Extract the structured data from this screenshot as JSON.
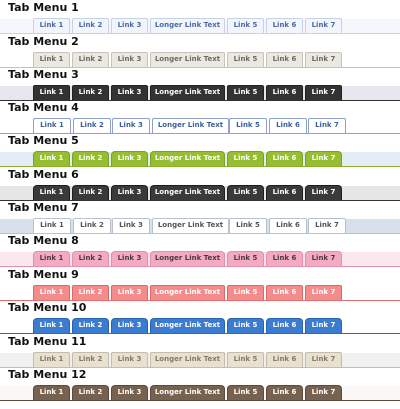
{
  "tabs": [
    "Link 1",
    "Link 2",
    "Link 3",
    "Longer Link Text",
    "Link 5",
    "Link 6",
    "Link 7"
  ],
  "menus": [
    {
      "title": "Tab Menu 1",
      "colors": {
        "bar": "#f4f7fc",
        "line": "#c6d3e6",
        "tab_bg": "#f2f5fb",
        "tab_fg": "#4a6aa6",
        "tab_border": "#c6d3e6"
      }
    },
    {
      "title": "Tab Menu 2",
      "colors": {
        "bar": "#ffffff",
        "line": "#c9c2b8",
        "tab_bg": "#ebe7e1",
        "tab_fg": "#6e6a64",
        "tab_border": "#c9c2b8"
      }
    },
    {
      "title": "Tab Menu 3",
      "colors": {
        "bar": "#e6e6ee",
        "line": "#333333",
        "tab_bg": "#333333",
        "tab_fg": "#ffffff",
        "tab_border": "#222222"
      }
    },
    {
      "title": "Tab Menu 4",
      "colors": {
        "bar": "#ffffff",
        "line": "#8aa2cc",
        "tab_bg": "#ffffff",
        "tab_fg": "#3e5f99",
        "tab_border": "#8aa2cc"
      }
    },
    {
      "title": "Tab Menu 5",
      "colors": {
        "bar": "#e4ecf6",
        "line": "#8dae2c",
        "tab_bg": "#96be32",
        "tab_fg": "#ffffff",
        "tab_border": "#7ea024"
      }
    },
    {
      "title": "Tab Menu 6",
      "colors": {
        "bar": "#e6e6e6",
        "line": "#333333",
        "tab_bg": "#3a3a3a",
        "tab_fg": "#ffffff",
        "tab_border": "#1e1e1e"
      }
    },
    {
      "title": "Tab Menu 7",
      "colors": {
        "bar": "#d8e0ea",
        "line": "#b8c2ce",
        "tab_bg": "#ffffff",
        "tab_fg": "#555555",
        "tab_border": "#b8c2ce"
      }
    },
    {
      "title": "Tab Menu 8",
      "colors": {
        "bar": "#fbe8ef",
        "line": "#e48fae",
        "tab_bg": "#f4a9c4",
        "tab_fg": "#4a3a40",
        "tab_border": "#e48fae"
      }
    },
    {
      "title": "Tab Menu 9",
      "colors": {
        "bar": "#ffffff",
        "line": "#e07070",
        "tab_bg": "#f48c8c",
        "tab_fg": "#ffffff",
        "tab_border": "#d86a6a"
      }
    },
    {
      "title": "Tab Menu 10",
      "colors": {
        "bar": "#ffffff",
        "line": "#2f69b8",
        "tab_bg": "#3b7cd0",
        "tab_fg": "#ffffff",
        "tab_border": "#2a62ae"
      }
    },
    {
      "title": "Tab Menu 11",
      "colors": {
        "bar": "#f1f1f1",
        "line": "#c8bda6",
        "tab_bg": "#e9e1d0",
        "tab_fg": "#857a66",
        "tab_border": "#c8bda6"
      }
    },
    {
      "title": "Tab Menu 12",
      "colors": {
        "bar": "#faf8f6",
        "line": "#5e4a3c",
        "tab_bg": "#77614f",
        "tab_fg": "#ffffff",
        "tab_border": "#5e4a3c"
      }
    }
  ]
}
